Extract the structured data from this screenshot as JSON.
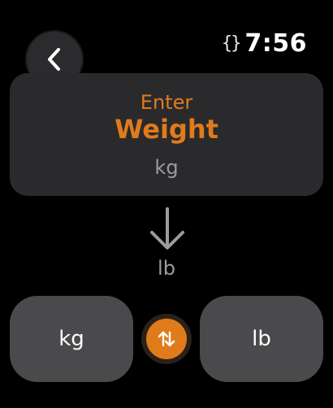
{
  "header": {
    "back_icon": "chevron-left-icon",
    "status_icon": "braces-icon",
    "status_glyph": "{}",
    "time": "7:56"
  },
  "input": {
    "prompt": "Enter",
    "field_name": "Weight",
    "from_unit": "kg"
  },
  "conversion": {
    "arrow_icon": "arrow-down-icon",
    "to_unit": "lb"
  },
  "buttons": {
    "left_label": "kg",
    "swap_icon": "swap-arrows-icon",
    "right_label": "lb"
  },
  "colors": {
    "accent": "#e07b1c",
    "card": "#2a2a2c",
    "button": "#4a4a4c"
  }
}
